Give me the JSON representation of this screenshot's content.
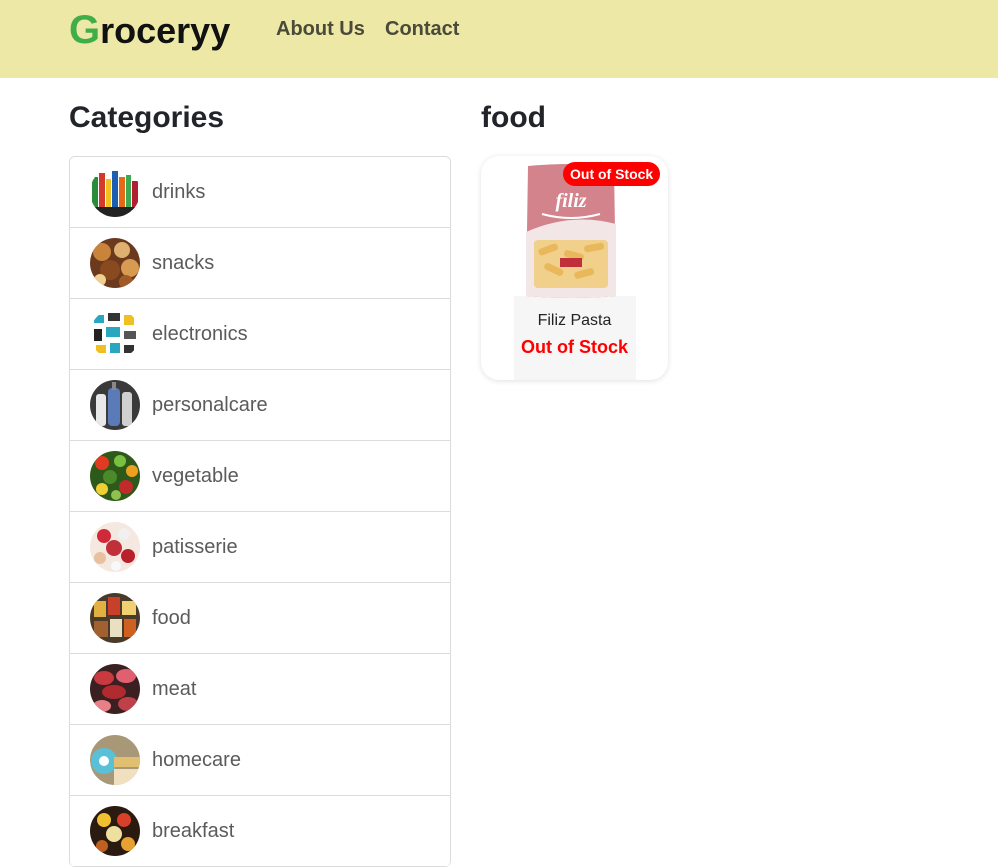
{
  "navbar": {
    "brand_first": "G",
    "brand_rest": "roceryy",
    "links": [
      "About Us",
      "Contact"
    ],
    "bg_color": "#ede8a6",
    "brand_accent": "#3fae48"
  },
  "sidebar": {
    "heading": "Categories",
    "items": [
      {
        "label": "drinks",
        "icon": "drinks-thumbnail-icon"
      },
      {
        "label": "snacks",
        "icon": "snacks-thumbnail-icon"
      },
      {
        "label": "electronics",
        "icon": "electronics-thumbnail-icon"
      },
      {
        "label": "personalcare",
        "icon": "personalcare-thumbnail-icon"
      },
      {
        "label": "vegetable",
        "icon": "vegetable-thumbnail-icon"
      },
      {
        "label": "patisserie",
        "icon": "patisserie-thumbnail-icon"
      },
      {
        "label": "food",
        "icon": "food-thumbnail-icon"
      },
      {
        "label": "meat",
        "icon": "meat-thumbnail-icon"
      },
      {
        "label": "homecare",
        "icon": "homecare-thumbnail-icon"
      },
      {
        "label": "breakfast",
        "icon": "breakfast-thumbnail-icon"
      }
    ]
  },
  "main": {
    "heading": "food",
    "products": [
      {
        "name": "Filiz Pasta",
        "badge": "Out of Stock",
        "status": "Out of Stock",
        "pack_brand": "filiz",
        "status_color": "#ff0000"
      }
    ]
  }
}
